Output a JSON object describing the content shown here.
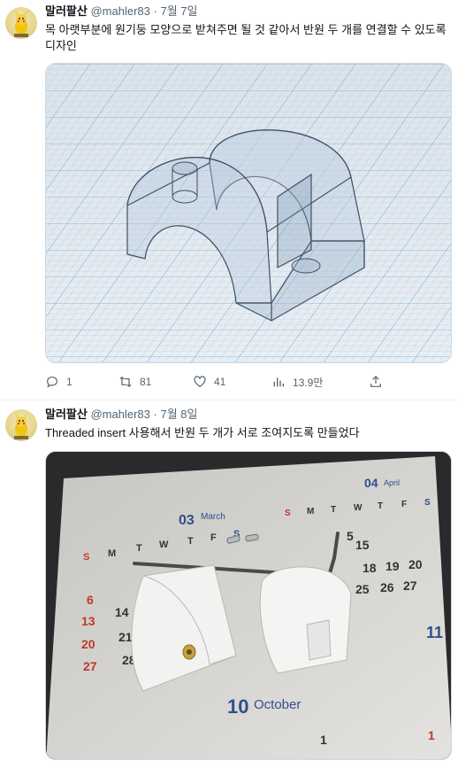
{
  "tweets": [
    {
      "author": {
        "name": "말러팔산",
        "handle": "@mahler83",
        "date": "7월 7일"
      },
      "text": "목 아랫부분에 원기둥 모양으로 받쳐주면 될 것 같아서 반원 두 개를 연결할 수 있도록 디자인",
      "media_alt": "3D model render of a half-cylinder support on a grid",
      "actions": {
        "replies": "1",
        "retweets": "81",
        "likes": "41",
        "views": "13.9만"
      }
    },
    {
      "author": {
        "name": "말러팔산",
        "handle": "@mahler83",
        "date": "7월 8일"
      },
      "text": "Threaded insert 사용해서 반원 두 개가 서로 조여지도록 만들었다",
      "media_alt": "Photo of two white 3D printed half-cylinder parts with screws and a hex key on a calendar",
      "calendar": {
        "month1_num": "03",
        "month1_name": "March",
        "month2_num": "04",
        "month2_name": "April",
        "month3_num": "10",
        "month3_name": "October",
        "day_headers": [
          "S",
          "M",
          "T",
          "W",
          "T",
          "F",
          "S"
        ],
        "row_numbers": [
          "5",
          "6",
          "13",
          "20",
          "27",
          "14",
          "21",
          "28",
          "11",
          "15",
          "18",
          "19",
          "20",
          "25",
          "26",
          "27",
          "1",
          "1"
        ]
      }
    }
  ],
  "separator": "·",
  "colors": {
    "text_primary": "#0f1419",
    "text_secondary": "#536471",
    "divider": "#eff3f4",
    "grid_blue": "#9dc3e6"
  }
}
